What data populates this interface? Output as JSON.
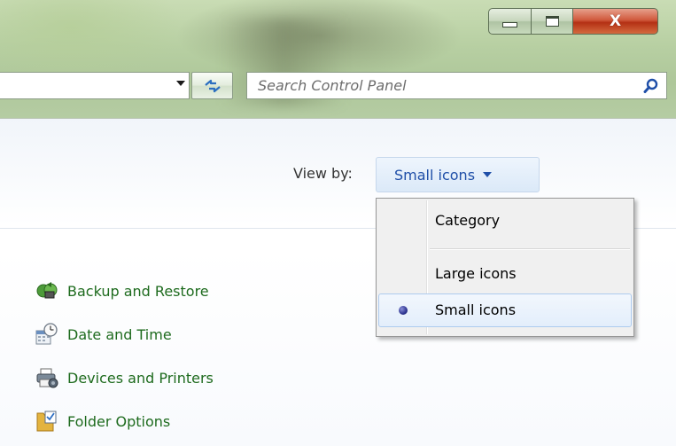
{
  "window": {
    "caption_buttons": {
      "minimize_icon": "minimize-icon",
      "maximize_icon": "maximize-icon",
      "close_label": "X"
    }
  },
  "toolbar": {
    "search_placeholder": "Search Control Panel"
  },
  "view_by": {
    "label": "View by:",
    "value": "Small icons"
  },
  "view_menu": {
    "items": [
      {
        "label": "Category",
        "selected": false
      },
      {
        "label": "Large icons",
        "selected": false
      },
      {
        "label": "Small icons",
        "selected": true
      }
    ]
  },
  "items": [
    {
      "label": "Backup and Restore",
      "icon": "backup-restore-icon"
    },
    {
      "label": "Date and Time",
      "icon": "date-time-icon"
    },
    {
      "label": "Devices and Printers",
      "icon": "devices-printers-icon"
    },
    {
      "label": "Folder Options",
      "icon": "folder-options-icon"
    }
  ],
  "colors": {
    "link_green": "#1e6b1e",
    "accent_blue": "#1f4fa8",
    "close_red": "#c33d1e"
  }
}
